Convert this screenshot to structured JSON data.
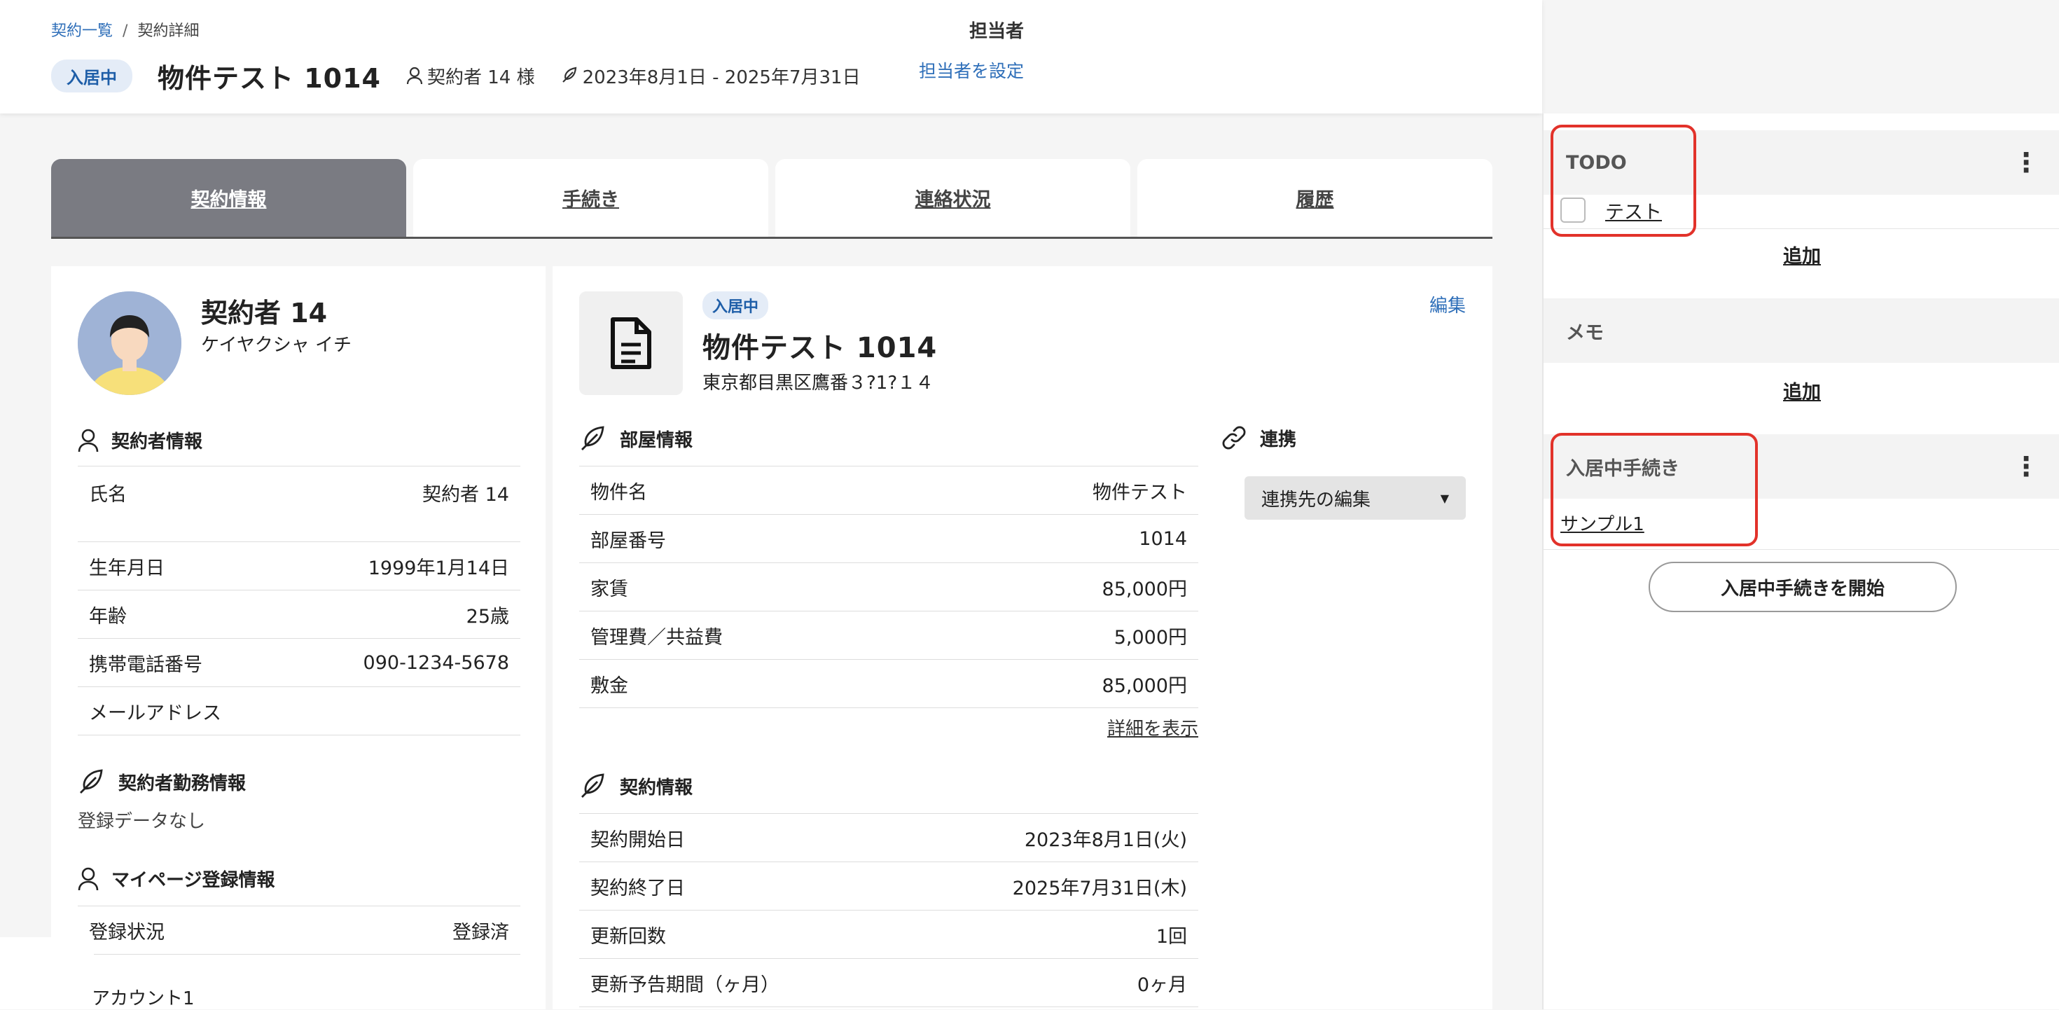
{
  "breadcrumb": {
    "parent": "契約一覧",
    "separator": "/",
    "current": "契約詳細"
  },
  "header": {
    "status_badge": "入居中",
    "title": "物件テスト 1014",
    "contractor": "契約者 14 様",
    "period": "2023年8月1日 - 2025年7月31日",
    "assignee_label": "担当者",
    "assignee_link": "担当者を設定"
  },
  "tabs": [
    {
      "label": "契約情報",
      "active": true
    },
    {
      "label": "手続き",
      "active": false
    },
    {
      "label": "連絡状況",
      "active": false
    },
    {
      "label": "履歴",
      "active": false
    }
  ],
  "person": {
    "name": "契約者 14",
    "kana": "ケイヤクシャ イチ",
    "info_title": "契約者情報",
    "info_rows": [
      {
        "label": "氏名",
        "value": "契約者 14"
      },
      {
        "label": "生年月日",
        "value": "1999年1月14日"
      },
      {
        "label": "年齢",
        "value": "25歳"
      },
      {
        "label": "携帯電話番号",
        "value": "090-1234-5678"
      },
      {
        "label": "メールアドレス",
        "value": ""
      }
    ],
    "work_title": "契約者勤務情報",
    "work_empty": "登録データなし",
    "mypage_title": "マイページ登録情報",
    "mypage_rows": [
      {
        "label": "登録状況",
        "value": "登録済"
      }
    ],
    "account_label": "アカウント1"
  },
  "property": {
    "status_badge": "入居中",
    "title": "物件テスト 1014",
    "address": "東京都目黒区鷹番３?1?１４",
    "edit_label": "編集",
    "room_title": "部屋情報",
    "room_rows": [
      {
        "label": "物件名",
        "value": "物件テスト"
      },
      {
        "label": "部屋番号",
        "value": "1014"
      },
      {
        "label": "家賃",
        "value": "85,000円"
      },
      {
        "label": "管理費／共益費",
        "value": "5,000円"
      },
      {
        "label": "敷金",
        "value": "85,000円"
      }
    ],
    "detail_link": "詳細を表示",
    "contract_title": "契約情報",
    "contract_rows": [
      {
        "label": "契約開始日",
        "value": "2023年8月1日(火)"
      },
      {
        "label": "契約終了日",
        "value": "2025年7月31日(木)"
      },
      {
        "label": "更新回数",
        "value": "1回"
      },
      {
        "label": "更新予告期間（ヶ月）",
        "value": "0ヶ月"
      }
    ],
    "link_title": "連携",
    "link_dropdown": "連携先の編集"
  },
  "sidebar": {
    "todo_title": "TODO",
    "todo_items": [
      {
        "label": "テスト",
        "checked": false
      }
    ],
    "todo_add": "追加",
    "memo_title": "メモ",
    "memo_add": "追加",
    "proc_title": "入居中手続き",
    "proc_items": [
      "サンプル1"
    ],
    "proc_start": "入居中手続きを開始"
  },
  "colors": {
    "accent": "#2f6fb9",
    "highlight": "#e2322a",
    "active_tab": "#7a7b82"
  }
}
